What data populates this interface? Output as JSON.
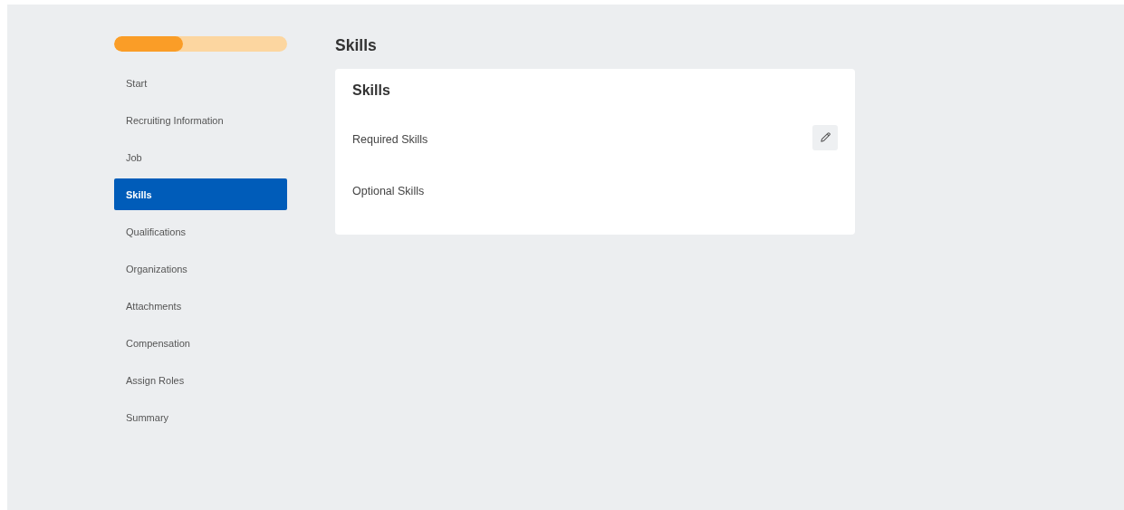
{
  "progress": {
    "level": 0.4
  },
  "nav": {
    "items": [
      {
        "label": "Start",
        "selected": false
      },
      {
        "label": "Recruiting Information",
        "selected": false
      },
      {
        "label": "Job",
        "selected": false
      },
      {
        "label": "Skills",
        "selected": true
      },
      {
        "label": "Qualifications",
        "selected": false
      },
      {
        "label": "Organizations",
        "selected": false
      },
      {
        "label": "Attachments",
        "selected": false
      },
      {
        "label": "Compensation",
        "selected": false
      },
      {
        "label": "Assign Roles",
        "selected": false
      },
      {
        "label": "Summary",
        "selected": false
      }
    ]
  },
  "page_title": "Skills",
  "card": {
    "title": "Skills",
    "fields": [
      {
        "label": "Required Skills",
        "editable": true
      },
      {
        "label": "Optional Skills",
        "editable": false
      }
    ]
  }
}
